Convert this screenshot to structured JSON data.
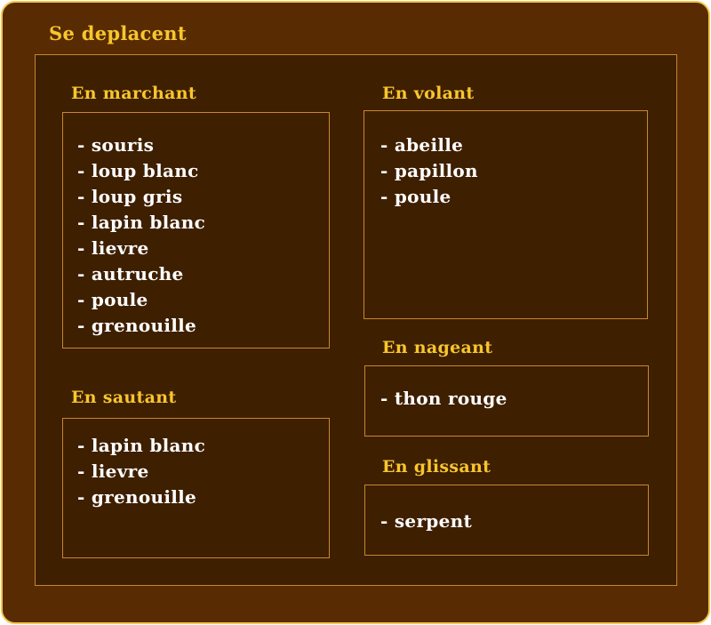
{
  "title": "Se deplacent",
  "sections": {
    "marchant": {
      "title": "En marchant",
      "items": [
        "souris",
        "loup blanc",
        "loup gris",
        "lapin blanc",
        "lievre",
        "autruche",
        "poule",
        "grenouille"
      ]
    },
    "volant": {
      "title": "En volant",
      "items": [
        "abeille",
        "papillon",
        "poule"
      ]
    },
    "sautant": {
      "title": "En sautant",
      "items": [
        "lapin blanc",
        "lievre",
        "grenouille"
      ]
    },
    "nageant": {
      "title": "En nageant",
      "items": [
        "thon rouge"
      ]
    },
    "glissant": {
      "title": "En glissant",
      "items": [
        "serpent"
      ]
    }
  },
  "colors": {
    "outer_background": "#582b02",
    "inner_background": "#3e1f00",
    "outer_border": "#f2c64b",
    "box_border": "#c8872e",
    "heading": "#f7c62d",
    "item_text": "#ffffff"
  }
}
